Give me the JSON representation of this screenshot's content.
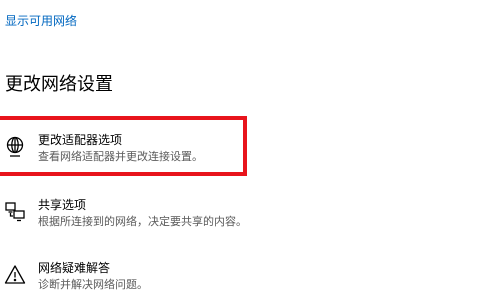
{
  "show_networks_link": "显示可用网络",
  "section_title": "更改网络设置",
  "options": [
    {
      "title": "更改适配器选项",
      "description": "查看网络适配器并更改连接设置。",
      "icon": "network-adapter-icon"
    },
    {
      "title": "共享选项",
      "description": "根据所连接到的网络，决定要共享的内容。",
      "icon": "sharing-icon"
    },
    {
      "title": "网络疑难解答",
      "description": "诊断并解决网络问题。",
      "icon": "warning-icon"
    }
  ],
  "colors": {
    "link": "#0067c0",
    "highlight": "#e8141c",
    "description": "#5a5a5a"
  }
}
